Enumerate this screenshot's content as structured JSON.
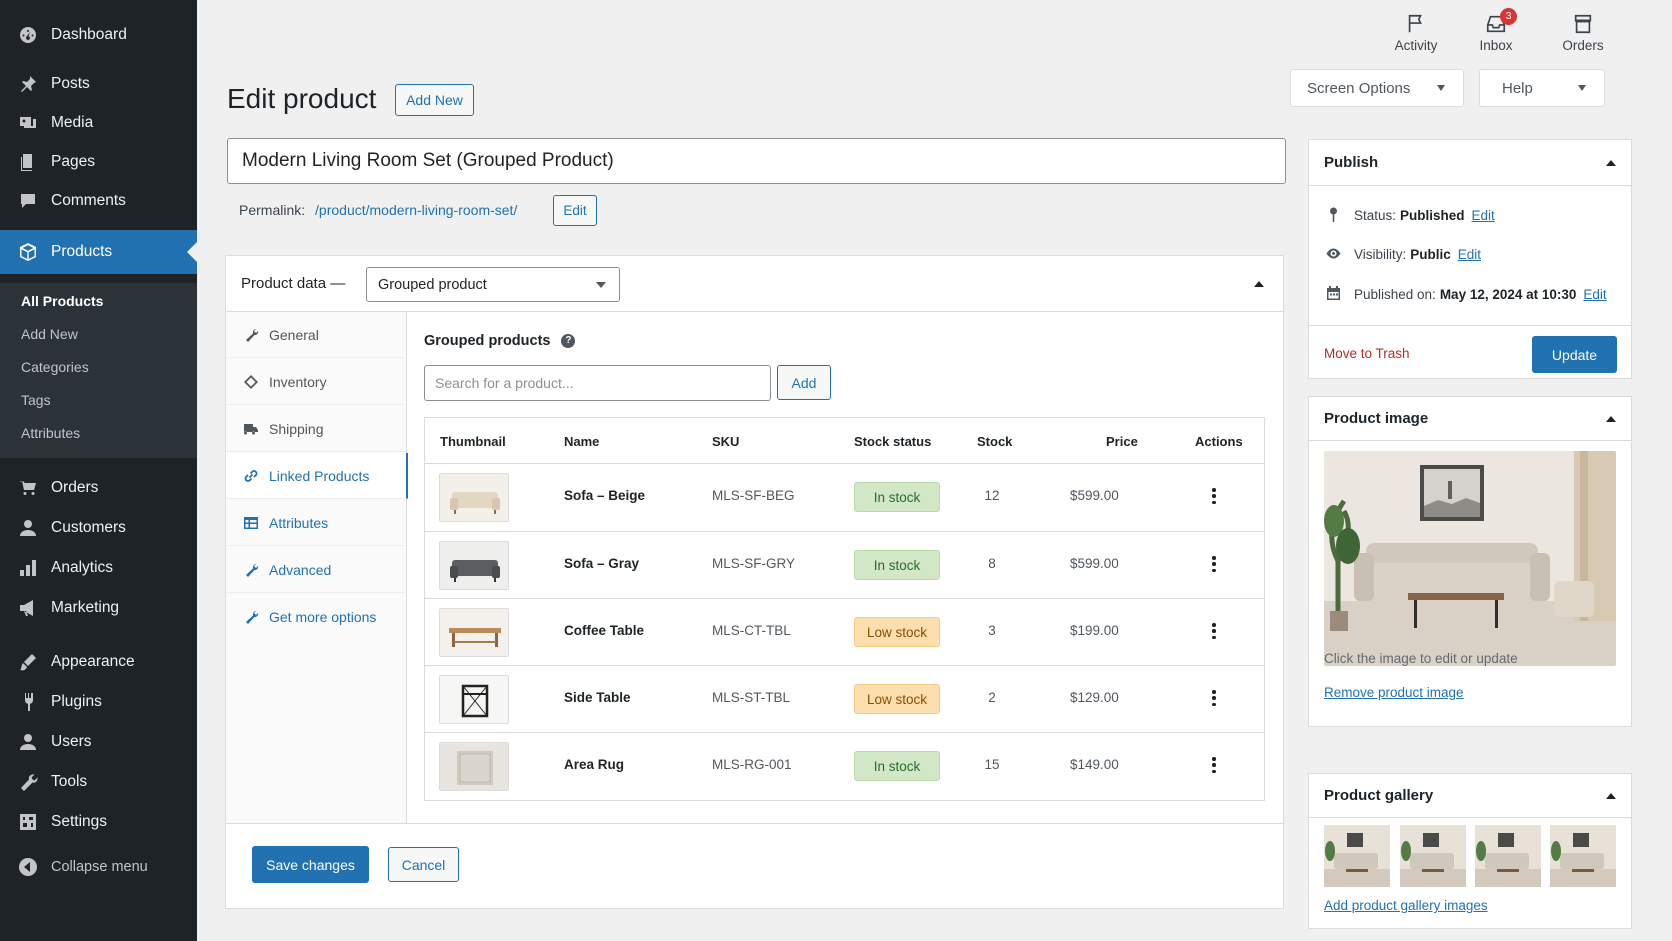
{
  "sidebar": {
    "dashboard": "Dashboard",
    "posts": "Posts",
    "media": "Media",
    "pages": "Pages",
    "comments": "Comments",
    "products": "Products",
    "submenu": [
      "All Products",
      "Add New",
      "Categories",
      "Tags",
      "Attributes"
    ],
    "orders": "Orders",
    "customers": "Customers",
    "analytics": "Analytics",
    "marketing": "Marketing",
    "appearance": "Appearance",
    "plugins": "Plugins",
    "users": "Users",
    "tools": "Tools",
    "settings": "Settings",
    "collapse": "Collapse menu"
  },
  "topbar": {
    "activity": "Activity",
    "inbox": "Inbox",
    "inbox_badge": "3",
    "orders": "Orders",
    "screen_options": "Screen Options",
    "help": "Help"
  },
  "page": {
    "title": "Edit product",
    "add_new": "Add New",
    "product_title": "Modern Living Room Set (Grouped Product)",
    "permalink_label": "Permalink:",
    "permalink_url": "/product/modern-living-room-set/",
    "permalink_edit": "Edit"
  },
  "product_data": {
    "label": "Product data —",
    "type": "Grouped product",
    "tabs": [
      "General",
      "Inventory",
      "Shipping",
      "Linked Products",
      "Attributes",
      "Advanced",
      "Get more options"
    ],
    "grouped_label": "Grouped products",
    "search_placeholder": "Search for a product...",
    "add_button": "Add",
    "columns": [
      "Thumbnail",
      "Name",
      "SKU",
      "Stock status",
      "Stock",
      "Price",
      "Actions"
    ],
    "rows": [
      {
        "name": "Sofa – Beige",
        "sku": "MLS-SF-BEG",
        "status": "In stock",
        "stock": "12",
        "price": "$599.00"
      },
      {
        "name": "Sofa – Gray",
        "sku": "MLS-SF-GRY",
        "status": "In stock",
        "stock": "8",
        "price": "$599.00"
      },
      {
        "name": "Coffee Table",
        "sku": "MLS-CT-TBL",
        "status": "Low stock",
        "stock": "3",
        "price": "$199.00"
      },
      {
        "name": "Side Table",
        "sku": "MLS-ST-TBL",
        "status": "Low stock",
        "stock": "2",
        "price": "$129.00"
      },
      {
        "name": "Area Rug",
        "sku": "MLS-RG-001",
        "status": "In stock",
        "stock": "15",
        "price": "$149.00"
      }
    ],
    "save": "Save changes",
    "cancel": "Cancel"
  },
  "publish": {
    "title": "Publish",
    "status_label": "Status:",
    "status_value": "Published",
    "visibility_label": "Visibility:",
    "visibility_value": "Public",
    "published_label": "Published on:",
    "published_value": "May 12, 2024 at 10:30",
    "edit": "Edit",
    "trash": "Move to Trash",
    "update": "Update"
  },
  "product_image": {
    "title": "Product image",
    "hint": "Click the image to edit or update",
    "remove": "Remove product image"
  },
  "gallery": {
    "title": "Product gallery",
    "add": "Add product gallery images"
  },
  "colors": {
    "sidebar": "#1d2327",
    "accent": "#2271b1",
    "in_stock": "#d1e7c5",
    "low_stock": "#fcdfac",
    "trash": "#b32d2e",
    "badge": "#d63638"
  }
}
